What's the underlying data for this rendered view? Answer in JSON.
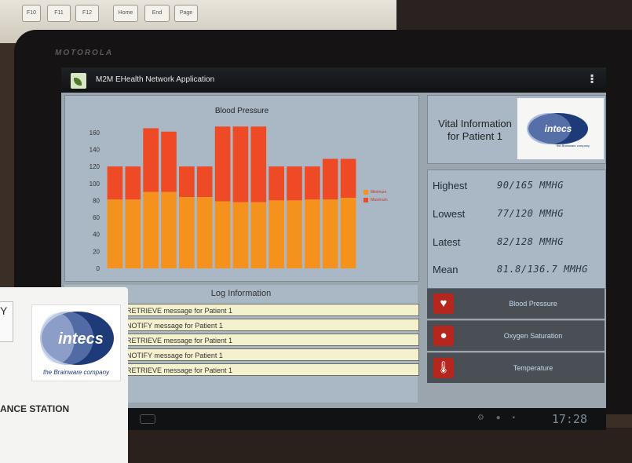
{
  "surroundings": {
    "keys": [
      "F10",
      "F11",
      "F12",
      "Home",
      "End",
      "Page"
    ],
    "tablet_brand": "MOTOROLA"
  },
  "app": {
    "title": "M2M EHealth Network Application"
  },
  "chart_data": {
    "type": "bar",
    "title": "Blood Pressure",
    "stacked": true,
    "ylim": [
      0,
      170
    ],
    "yticks": [
      0,
      20,
      40,
      60,
      80,
      100,
      120,
      140,
      160
    ],
    "legend_placement": "right",
    "series": [
      {
        "name": "Minimum",
        "color": "#f5921e",
        "values": [
          81,
          81,
          90,
          90,
          84,
          84,
          79,
          78,
          78,
          80,
          80,
          81,
          81,
          83
        ]
      },
      {
        "name": "Maximum",
        "color": "#ee4a26",
        "values": [
          120,
          120,
          165,
          161,
          120,
          120,
          167,
          167,
          167,
          120,
          120,
          120,
          129,
          129
        ]
      }
    ]
  },
  "log": {
    "title": "Log Information",
    "entries": [
      "RETRIEVE message for Patient 1",
      "NOTIFY message for Patient 1",
      "RETRIEVE message for Patient 1",
      "NOTIFY message for Patient 1",
      "RETRIEVE message for Patient 1"
    ]
  },
  "vital": {
    "line1": "Vital Information",
    "line2": "for Patient 1"
  },
  "logo": {
    "name": "intecs",
    "tagline": "the Brainware company"
  },
  "stats": [
    {
      "label": "Highest",
      "value": "90/165 MMHG"
    },
    {
      "label": "Lowest",
      "value": "77/120 MMHG"
    },
    {
      "label": "Latest",
      "value": "82/128 MMHG"
    },
    {
      "label": "Mean",
      "value": "81.8/136.7 MMHG"
    }
  ],
  "nav": [
    {
      "label": "Blood Pressure",
      "icon": "heart-gauge-icon"
    },
    {
      "label": "Oxygen Saturation",
      "icon": "drop-icon"
    },
    {
      "label": "Temperature",
      "icon": "thermometer-icon"
    }
  ],
  "system": {
    "clock": "17:28"
  },
  "card": {
    "y_label": "Y",
    "station": "ANCE STATION",
    "logo_name": "intecs",
    "logo_tagline": "the Brainware company"
  },
  "colors": {
    "minimum": "#f5921e",
    "maximum": "#ee4a26",
    "accent_red": "#b5271e"
  }
}
